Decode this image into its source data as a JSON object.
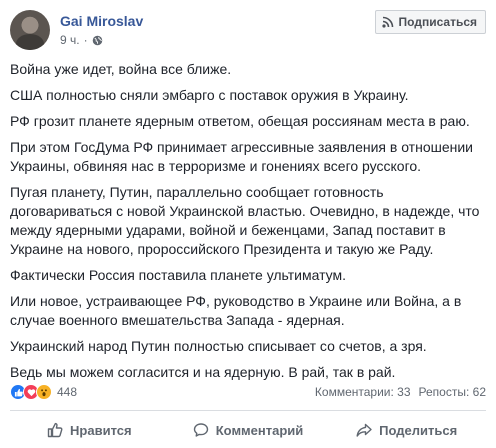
{
  "post": {
    "author": "Gai Miroslav",
    "time": "9 ч.",
    "dot": "·",
    "subscribe_label": "Подписаться",
    "paragraphs": [
      "Война уже идет, война все ближе.",
      "США полностью сняли эмбарго с поставок оружия в Украину.",
      "РФ грозит планете ядерным ответом, обещая россиянам места в раю.",
      "При этом ГосДума РФ принимает агрессивные заявления в отношении Украины, обвиняя нас в терроризме и гонениях всего русского.",
      "Пугая планету, Путин, параллельно сообщает готовность договариваться с новой Украинской властью. Очевидно, в надежде, что между ядерными ударами, войной и беженцами, Запад поставит в Украине на нового, пророссийского Президента и такую же Раду.",
      "Фактически Россия поставила планете ультиматум.",
      "Или новое, устраивающее РФ, руководство в Украине или Война, а в случае военного вмешательства Запада - ядерная.",
      "Украинский народ Путин полностью списывает со счетов, а зря.",
      "Ведь мы можем согласится и на ядерную. В рай, так в рай."
    ]
  },
  "stats": {
    "reaction_count": "448",
    "comments": "Комментарии: 33",
    "shares": "Репосты: 62",
    "reaction_icons": [
      "like-icon",
      "love-icon",
      "wow-icon"
    ]
  },
  "actions": {
    "like": "Нравится",
    "comment": "Комментарий",
    "share": "Поделиться"
  },
  "colors": {
    "link_blue": "#385898",
    "like_blue": "#2078f4",
    "love_red": "#f33e58",
    "wow_yellow": "#f7b125",
    "muted_text": "#606770"
  }
}
